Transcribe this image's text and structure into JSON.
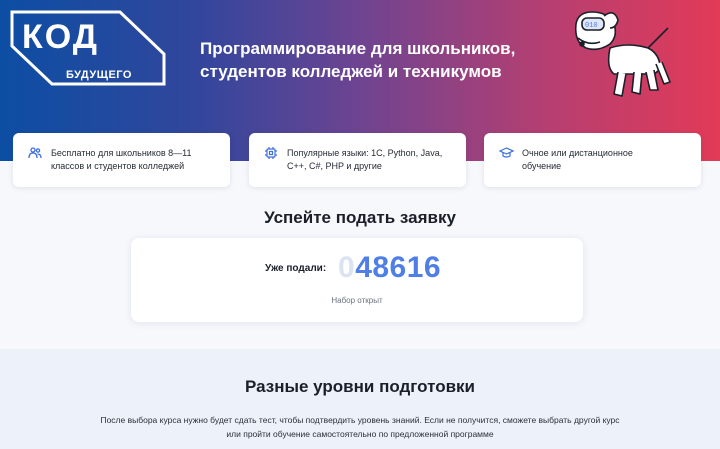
{
  "hero": {
    "logo_main": "КОД",
    "logo_sub": "БУДУЩЕГО",
    "title_line1": "Программирование для школьников,",
    "title_line2": "студентов колледжей и техникумов",
    "robot_badge": "010"
  },
  "features": [
    {
      "icon": "users-icon",
      "line1": "Бесплатно для школьников 8—11",
      "line2": "классов и студентов колледжей"
    },
    {
      "icon": "chip-icon",
      "line1": "Популярные языки: 1С, Python, Java,",
      "line2": "C++, C#, PHP и другие"
    },
    {
      "icon": "graduation-cap-icon",
      "line1": "Очное или дистанционное",
      "line2": "обучение"
    }
  ],
  "apply": {
    "title": "Успейте подать заявку",
    "counter_label": "Уже подали:",
    "counter_ghost_digit": "0",
    "counter_value": "48616",
    "status": "Набор открыт"
  },
  "levels": {
    "title": "Разные уровни подготовки",
    "desc_line1": "После выбора курса нужно будет сдать тест, чтобы подтвердить уровень знаний. Если не получится, сможете выбрать другой курс",
    "desc_line2": "или пройти обучение самостоятельно по предложенной программе"
  },
  "colors": {
    "gradient_start": "#0c4ea3",
    "gradient_end": "#e23a57",
    "accent_blue": "#4f7fe6"
  }
}
